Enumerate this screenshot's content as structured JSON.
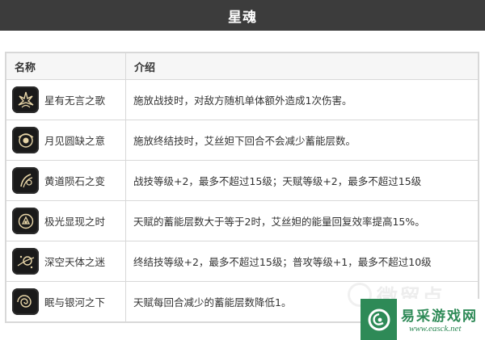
{
  "header": {
    "title": "星魂"
  },
  "table": {
    "columns": [
      "名称",
      "介绍"
    ],
    "rows": [
      {
        "name": "星有无言之歌",
        "icon": "flame-star-icon",
        "desc": "施放战技时，对敌方随机单体额外造成1次伤害。"
      },
      {
        "name": "月见圆缺之意",
        "icon": "moon-orbit-icon",
        "desc": "施放终结技时，艾丝妲下回合不会减少蓄能层数。"
      },
      {
        "name": "黄道陨石之变",
        "icon": "meteor-icon",
        "desc": "战技等级+2，最多不超过15级；天赋等级+2，最多不超过15级"
      },
      {
        "name": "极光显现之时",
        "icon": "aurora-lock-icon",
        "desc": "天赋的蓄能层数大于等于2时，艾丝妲的能量回复效率提高15%。"
      },
      {
        "name": "深空天体之迷",
        "icon": "celestial-body-icon",
        "desc": "终结技等级+2，最多不超过15级；普攻等级+1，最多不超过10级"
      },
      {
        "name": "眠与银河之下",
        "icon": "galaxy-swirl-icon",
        "desc": "天赋每回合减少的蓄能层数降低1。"
      }
    ]
  },
  "watermark": {
    "text": "微贸点"
  },
  "logo": {
    "name": "易采游戏网",
    "url": "www.easck.net",
    "color": "#2e8a57"
  }
}
